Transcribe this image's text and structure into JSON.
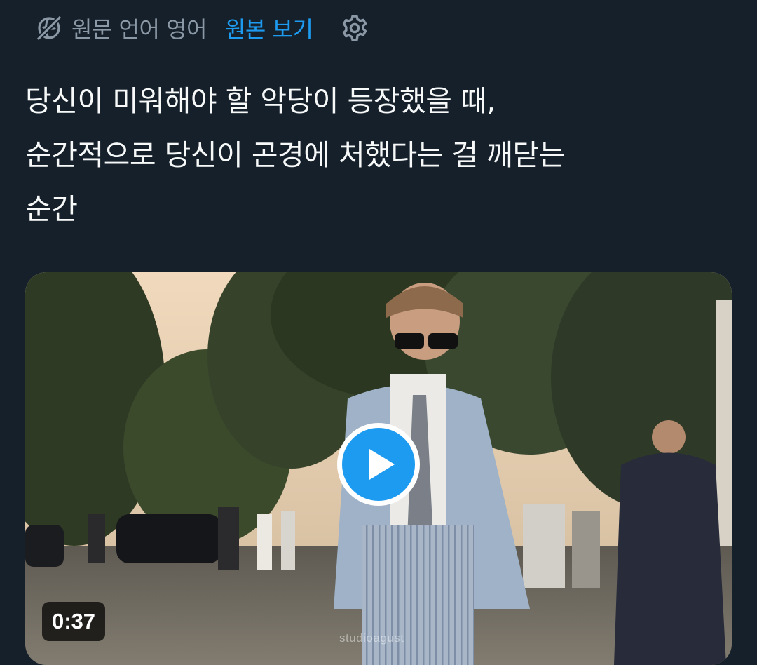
{
  "translation": {
    "source_language_text": "원문 언어 영어",
    "view_original_label": "원본 보기"
  },
  "tweet": {
    "text_lines": [
      "당신이 미워해야 할 악당이 등장했을 때,",
      "순간적으로 당신이 곤경에 처했다는 걸 깨닫는",
      "순간"
    ]
  },
  "media": {
    "duration": "0:37",
    "watermark": "studioagust"
  },
  "colors": {
    "background": "#15202b",
    "accent": "#1d9bf0",
    "secondary_text": "#8b98a5"
  },
  "icons": [
    "globe-translate-icon",
    "gear-icon",
    "play-icon"
  ]
}
